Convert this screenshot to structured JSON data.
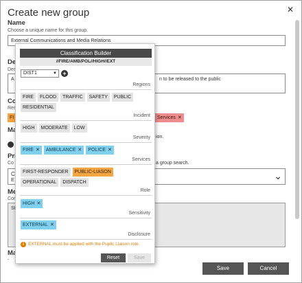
{
  "dialog": {
    "title": "Create new group",
    "close_icon": "close-icon",
    "name": {
      "label": "Name",
      "help": "Choose a unique name for this group.",
      "value": "External Communications and Media Relations"
    },
    "description": {
      "label_partial": "De",
      "help_partial": "Des",
      "value_start": "A",
      "value_end": "n to be released to the public"
    },
    "classification": {
      "label_partial": "Co",
      "help_partial": "Res",
      "chip_partial_left": "FI",
      "chip_services": "Services"
    },
    "managed": {
      "label_partial": "Ma",
      "text_partial": "ion."
    },
    "privacy": {
      "label_partial": "Pri",
      "help_partial": "Co",
      "text_partial": "a group search.",
      "select_partial": "C",
      "select_sub_partial": "E"
    },
    "members": {
      "label_partial": "Me",
      "help_partial": "Cor",
      "list_partial": "St"
    },
    "ma_bottom": {
      "label_partial": "Ma",
      "value_partial": "-"
    },
    "save_label": "Save",
    "cancel_label": "Cancel"
  },
  "builder": {
    "title": "Classification Builder",
    "code": "//FIRE/AMB/POL//HIGH//EXT",
    "district": "DIST1",
    "sections": {
      "regions": "Regions",
      "incident": "Incident",
      "severity": "Severity",
      "services": "Services",
      "role": "Role",
      "sensitivity": "Sensitivity",
      "disclosure": "Disclosure"
    },
    "incident_chips": [
      "FIRE",
      "FLOOD",
      "TRAFFIC",
      "SAFETY",
      "PUBLIC",
      "RESIDENTIAL"
    ],
    "severity_chips": [
      "HIGH",
      "MODERATE",
      "LOW"
    ],
    "services_chips": [
      "FIRE",
      "AMBULANCE",
      "POLICE"
    ],
    "role_chips": [
      "FIRST-RESPONDER",
      "PUBLIC-LIASON",
      "OPERATIONAL",
      "DISPATCH"
    ],
    "sensitivity_chips": [
      "HIGH"
    ],
    "disclosure_chips": [
      "EXTERNAL"
    ],
    "warning": "EXTERNAL must be applied with the Puplic Liaison role.",
    "reset_label": "Reset",
    "save_label": "Save",
    "colors": {
      "selected": "#7fd0ef",
      "highlight": "#f6a543",
      "warning": "#e07b00",
      "header": "#484848"
    }
  }
}
